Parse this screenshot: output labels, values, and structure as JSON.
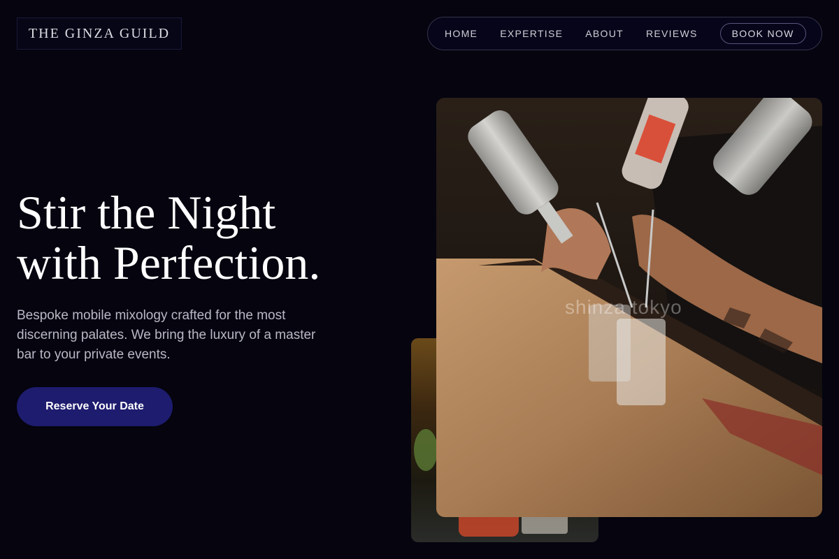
{
  "brand": {
    "logo_text": "THE GINZA GUILD"
  },
  "nav": {
    "links": [
      "HOME",
      "EXPERTISE",
      "ABOUT",
      "REVIEWS"
    ],
    "cta_label": "BOOK NOW"
  },
  "hero": {
    "headline_line1": "Stir the Night",
    "headline_line2": "with Perfection.",
    "subcopy": "Bespoke mobile mixology crafted for the most discerning palates. We bring the luxury of a master bar to your private events.",
    "cta_label": "Reserve Your Date"
  },
  "media": {
    "front_photo_watermark": "shinza tokyo"
  },
  "colors": {
    "background": "#05040f",
    "cta_background": "#1e1c6e",
    "nav_border": "#34334a"
  }
}
